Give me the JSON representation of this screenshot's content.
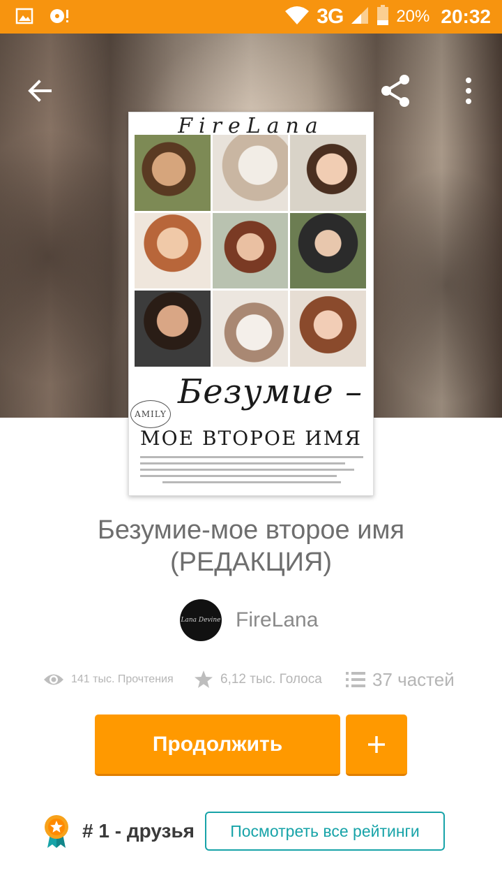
{
  "status_bar": {
    "network": "3G",
    "battery_percent": "20%",
    "time": "20:32",
    "icons": [
      "gallery-icon",
      "music-disc-icon",
      "wifi-icon",
      "signal-icon",
      "battery-icon"
    ]
  },
  "toolbar": {
    "icons": [
      "back-arrow-icon",
      "share-icon",
      "more-vert-icon"
    ]
  },
  "cover": {
    "author_text": "FireLana",
    "title_text": "Безумие –",
    "stamp_text": "AMILY",
    "subtitle_text": "МОЕ ВТОРОЕ ИМЯ"
  },
  "story": {
    "title_line1": "Безумие-мое второе имя",
    "title_line2": "(РЕДАКЦИЯ)",
    "author": "FireLana",
    "avatar_text": "Lana Devine"
  },
  "stats": {
    "reads": "141 тыс. Прочтения",
    "votes": "6,12 тыс. Голоса",
    "parts": "37 частей"
  },
  "actions": {
    "continue_label": "Продолжить",
    "add_icon": "plus-icon"
  },
  "ranking": {
    "rank_number": "# 1",
    "rank_tag": " - друзья",
    "view_all_label": "Посмотреть все рейтинги"
  },
  "colors": {
    "accent": "#ff9900",
    "status_bar": "#f7940f",
    "teal": "#17a3a8"
  }
}
